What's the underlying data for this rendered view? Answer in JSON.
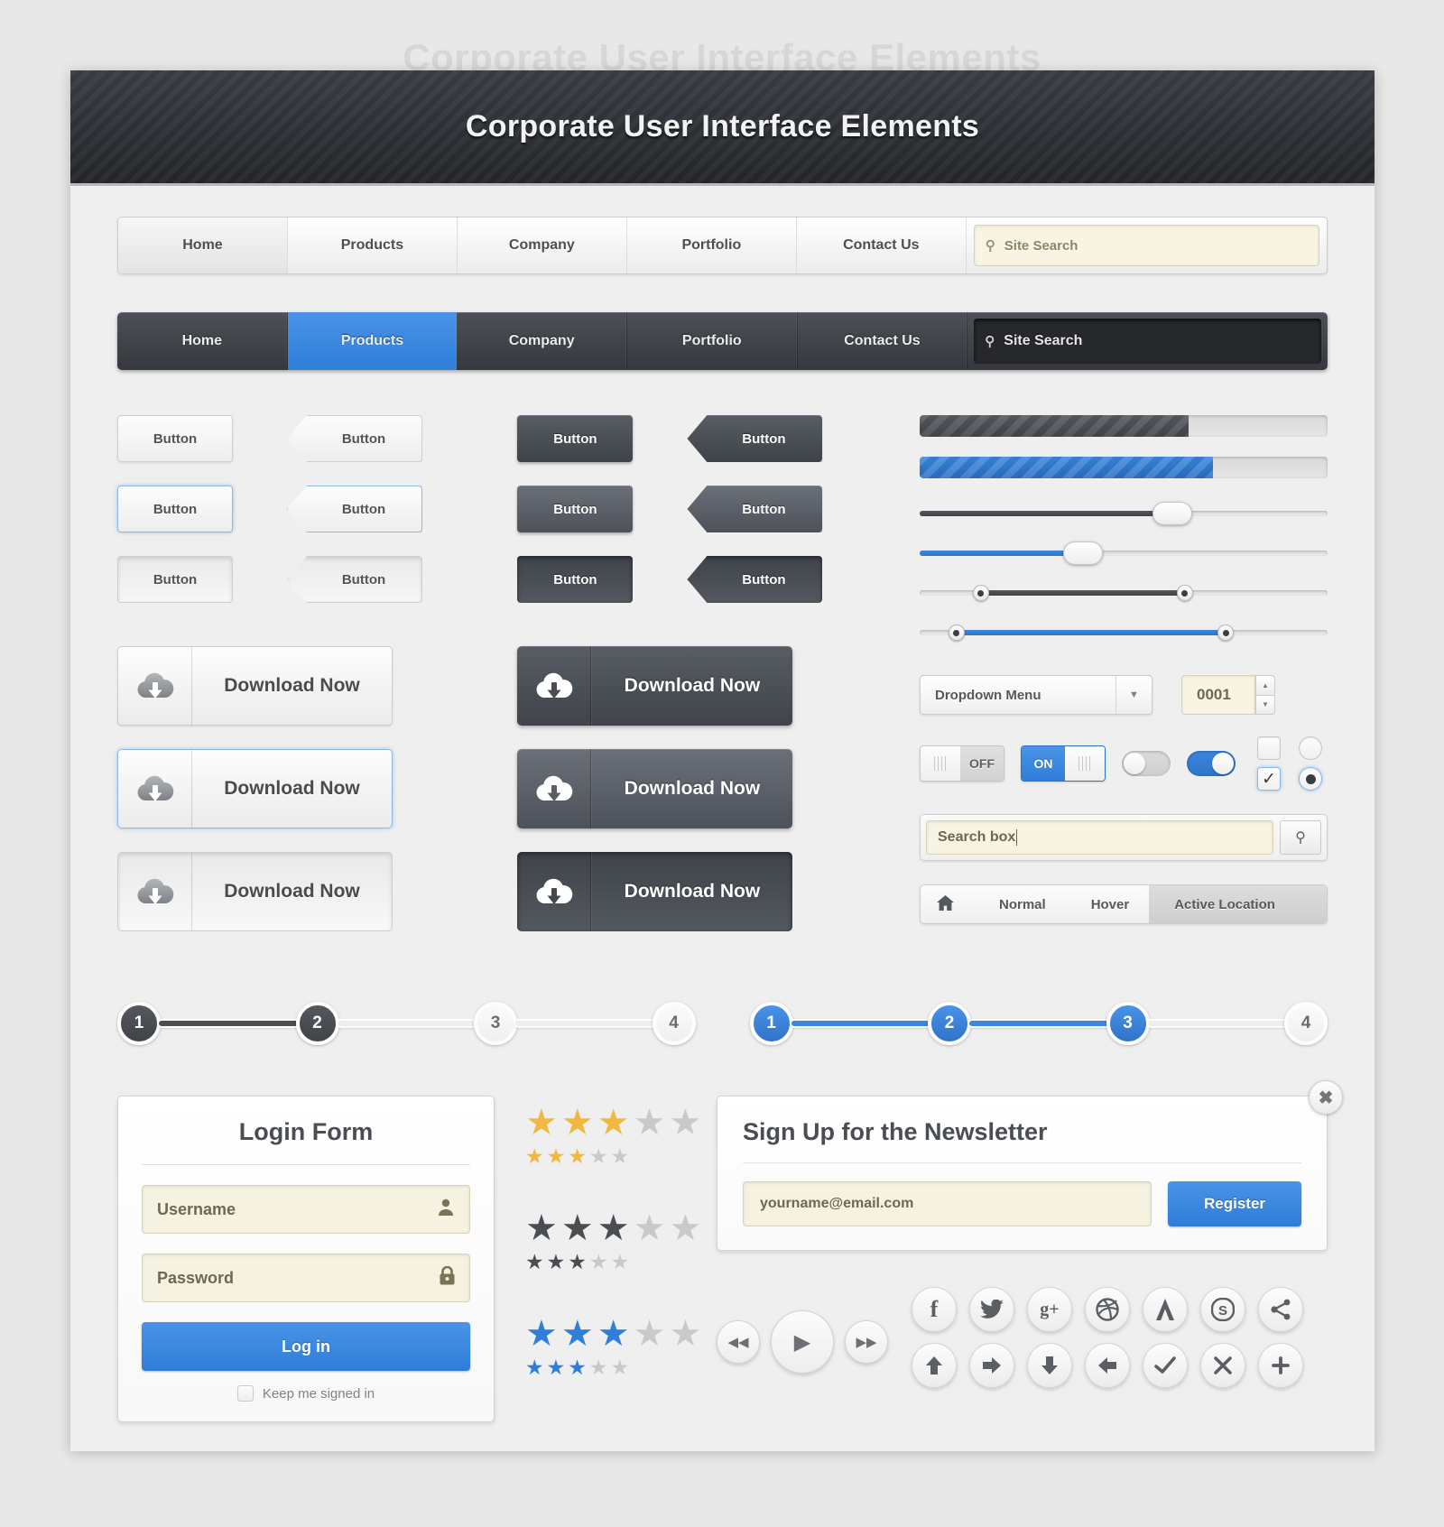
{
  "backdrop_title": "Corporate User Interface Elements",
  "titlebar": {
    "title": "Corporate User Interface Elements"
  },
  "nav_light": {
    "items": [
      "Home",
      "Products",
      "Company",
      "Portfolio",
      "Contact Us"
    ],
    "search_placeholder": "Site Search",
    "search_icon": "magnifier-icon",
    "active_index": 0
  },
  "nav_dark": {
    "items": [
      "Home",
      "Products",
      "Company",
      "Portfolio",
      "Contact Us"
    ],
    "search_placeholder": "Site Search",
    "search_icon": "magnifier-icon",
    "active_index": 1
  },
  "buttons": {
    "light": [
      {
        "label": "Button",
        "state": "normal"
      },
      {
        "label": "Button",
        "state": "selected"
      },
      {
        "label": "Button",
        "state": "active"
      }
    ],
    "light_arrow": [
      {
        "label": "Button",
        "state": "normal"
      },
      {
        "label": "Button",
        "state": "selected"
      },
      {
        "label": "Button",
        "state": "active"
      }
    ],
    "dark": [
      {
        "label": "Button",
        "state": "normal"
      },
      {
        "label": "Button",
        "state": "hover"
      },
      {
        "label": "Button",
        "state": "active"
      }
    ],
    "dark_arrow": [
      {
        "label": "Button",
        "state": "normal"
      },
      {
        "label": "Button",
        "state": "hover"
      },
      {
        "label": "Button",
        "state": "active"
      }
    ]
  },
  "downloads": {
    "icon": "cloud-download-icon",
    "light": [
      {
        "label": "Download Now",
        "state": "normal"
      },
      {
        "label": "Download Now",
        "state": "selected"
      },
      {
        "label": "Download Now",
        "state": "active"
      }
    ],
    "dark": [
      {
        "label": "Download Now",
        "state": "normal"
      },
      {
        "label": "Download Now",
        "state": "hover"
      },
      {
        "label": "Download Now",
        "state": "active"
      }
    ]
  },
  "progress": [
    {
      "style": "dark-striped",
      "percent": 66
    },
    {
      "style": "blue-striped",
      "percent": 72
    }
  ],
  "sliders": [
    {
      "style": "dark",
      "percent": 62
    },
    {
      "style": "blue",
      "percent": 40
    },
    {
      "style": "dark-range",
      "from": 15,
      "to": 65
    },
    {
      "style": "blue-range",
      "from": 9,
      "to": 75
    }
  ],
  "dropdown": {
    "label": "Dropdown Menu",
    "arrow_icon": "chevron-down-icon"
  },
  "spinner": {
    "value": "0001",
    "up_icon": "chevron-up-icon",
    "down_icon": "chevron-down-icon"
  },
  "toggles": {
    "off_label": "OFF",
    "on_label": "ON",
    "pill_off": "off",
    "pill_on": "on",
    "checkbox_checked_icon": "check-icon"
  },
  "searchbox": {
    "value": "Search box",
    "button_icon": "magnifier-icon"
  },
  "breadcrumb": {
    "home_icon": "home-icon",
    "items": [
      "Normal",
      "Hover",
      "Active Location"
    ]
  },
  "steps": {
    "dark": {
      "labels": [
        "1",
        "2",
        "3",
        "4"
      ],
      "completed": 2
    },
    "blue": {
      "labels": [
        "1",
        "2",
        "3",
        "4"
      ],
      "completed": 3
    }
  },
  "login": {
    "title": "Login Form",
    "username_placeholder": "Username",
    "username_icon": "user-icon",
    "password_placeholder": "Password",
    "password_icon": "lock-icon",
    "submit_label": "Log in",
    "keep_signed_label": "Keep me signed in"
  },
  "ratings": [
    {
      "color": "#f0b840",
      "filled": 3,
      "total": 5
    },
    {
      "color": "#4a4d52",
      "filled": 3,
      "total": 5
    },
    {
      "color": "#2f7ed8",
      "filled": 3,
      "total": 5
    }
  ],
  "newsletter": {
    "title": "Sign Up for the Newsletter",
    "email_placeholder": "yourname@email.com",
    "register_label": "Register",
    "close_icon": "close-icon"
  },
  "media_controls": [
    {
      "icon": "rewind-icon",
      "glyph": "◀◀",
      "size": "sm"
    },
    {
      "icon": "play-icon",
      "glyph": "▶",
      "size": "lg"
    },
    {
      "icon": "fast-forward-icon",
      "glyph": "▶▶",
      "size": "sm"
    }
  ],
  "social_icons": [
    {
      "name": "facebook-icon",
      "glyph": "f"
    },
    {
      "name": "twitter-icon",
      "glyph": "✉"
    },
    {
      "name": "google-plus-icon",
      "glyph": "g+"
    },
    {
      "name": "dribbble-icon",
      "glyph": "◎"
    },
    {
      "name": "forrst-icon",
      "glyph": "Λ"
    },
    {
      "name": "skype-icon",
      "glyph": "S"
    },
    {
      "name": "share-icon",
      "glyph": "≪"
    }
  ],
  "arrow_icons": [
    {
      "name": "arrow-up-icon",
      "glyph": "↑"
    },
    {
      "name": "arrow-right-icon",
      "glyph": "→"
    },
    {
      "name": "arrow-down-icon",
      "glyph": "↓"
    },
    {
      "name": "arrow-left-icon",
      "glyph": "←"
    },
    {
      "name": "check-icon",
      "glyph": "✓"
    },
    {
      "name": "close-icon",
      "glyph": "✕"
    },
    {
      "name": "plus-icon",
      "glyph": "＋"
    }
  ],
  "colors": {
    "accent_blue": "#2f7ed8",
    "dark": "#3f434a",
    "cream": "#f5f2e2",
    "star_gold": "#f0b840"
  }
}
